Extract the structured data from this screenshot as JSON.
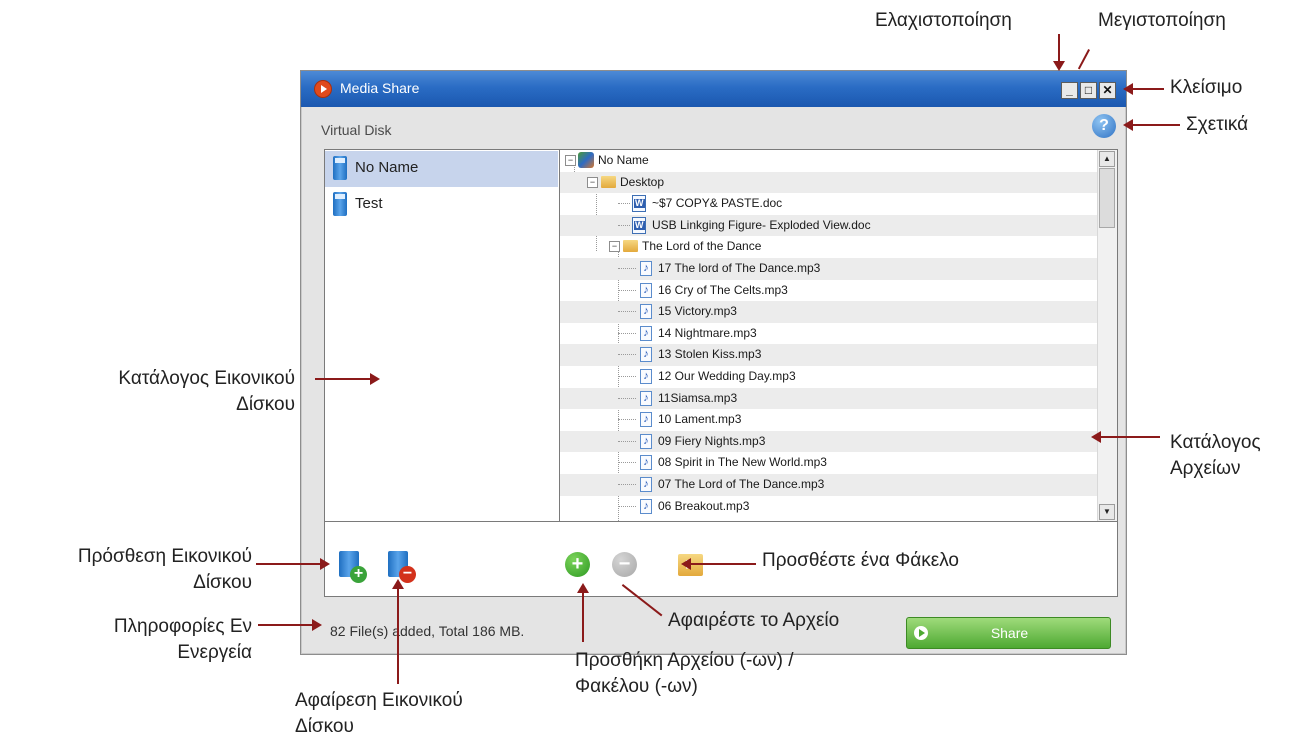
{
  "window": {
    "title": "Media Share",
    "controls": {
      "minimize": "_",
      "maximize": "□",
      "close": "✕"
    },
    "help_icon": "?"
  },
  "virtual_disk": {
    "label": "Virtual Disk",
    "items": [
      {
        "label": "No Name",
        "selected": true
      },
      {
        "label": "Test",
        "selected": false
      }
    ]
  },
  "file_tree": {
    "rows": [
      {
        "label": "No Name",
        "icon": "user-folder-icon"
      },
      {
        "label": "Desktop",
        "icon": "folder-icon"
      },
      {
        "label": "~$7 COPY& PASTE.doc",
        "icon": "word-doc-icon"
      },
      {
        "label": "USB Linkging Figure- Exploded View.doc",
        "icon": "word-doc-icon"
      },
      {
        "label": "The Lord of the Dance",
        "icon": "folder-icon"
      },
      {
        "label": "17 The lord of The Dance.mp3",
        "icon": "audio-file-icon"
      },
      {
        "label": "16 Cry of The Celts.mp3",
        "icon": "audio-file-icon"
      },
      {
        "label": "15 Victory.mp3",
        "icon": "audio-file-icon"
      },
      {
        "label": "14 Nightmare.mp3",
        "icon": "audio-file-icon"
      },
      {
        "label": "13 Stolen Kiss.mp3",
        "icon": "audio-file-icon"
      },
      {
        "label": "12 Our Wedding Day.mp3",
        "icon": "audio-file-icon"
      },
      {
        "label": "11Siamsa.mp3",
        "icon": "audio-file-icon"
      },
      {
        "label": "10 Lament.mp3",
        "icon": "audio-file-icon"
      },
      {
        "label": "09 Fiery Nights.mp3",
        "icon": "audio-file-icon"
      },
      {
        "label": "08 Spirit in The New World.mp3",
        "icon": "audio-file-icon"
      },
      {
        "label": "07 The Lord of The Dance.mp3",
        "icon": "audio-file-icon"
      },
      {
        "label": "06 Breakout.mp3",
        "icon": "audio-file-icon"
      }
    ]
  },
  "toolbar": {
    "add_vd_icon": "+",
    "remove_vd_icon": "−",
    "add_files_icon": "+",
    "remove_file_icon": "−"
  },
  "status": {
    "text": "82 File(s) added, Total 186 MB."
  },
  "share_button": {
    "label": "Share"
  },
  "annotations": {
    "minimize": "Ελαχιστοποίηση",
    "maximize": "Μεγιστοποίηση",
    "close": "Κλείσιμο",
    "about": "Σχετικά",
    "vd_list_line1": "Κατάλογος Εικονικού",
    "vd_list_line2": "Δίσκου",
    "file_list_line1": "Κατάλογος",
    "file_list_line2": "Αρχείων",
    "add_vd_line1": "Πρόσθεση Εικονικού",
    "add_vd_line2": "Δίσκου",
    "info_line1": "Πληροφορίες Εν",
    "info_line2": "Ενεργεία",
    "remove_vd_line1": "Αφαίρεση Εικονικού",
    "remove_vd_line2": "Δίσκου",
    "add_folder": "Προσθέστε ένα Φάκελο",
    "remove_file": "Αφαιρέστε το Αρχείο",
    "add_files_line1": "Προσθήκη Αρχείου (-ων) /",
    "add_files_line2": "Φακέλου (-ων)"
  }
}
